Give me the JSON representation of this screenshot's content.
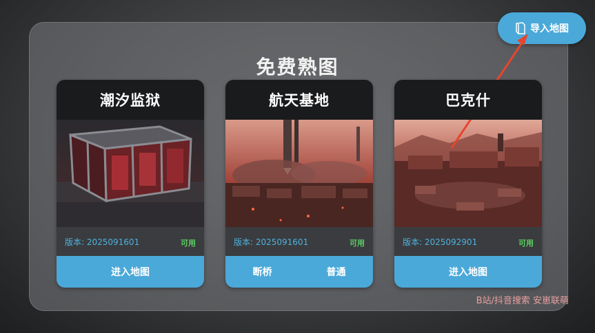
{
  "page": {
    "title": "免费熟图",
    "footer": "B站/抖音搜索 安崽联萌"
  },
  "import_button": {
    "label": "导入地图",
    "icon": "map-book-icon"
  },
  "cards": [
    {
      "title": "潮汐监狱",
      "version": "版本: 2025091601",
      "status": "可用",
      "actions": [
        "进入地图"
      ]
    },
    {
      "title": "航天基地",
      "version": "版本: 2025091601",
      "status": "可用",
      "actions": [
        "断桥",
        "普通"
      ]
    },
    {
      "title": "巴克什",
      "version": "版本: 2025092901",
      "status": "可用",
      "actions": [
        "进入地图"
      ]
    }
  ],
  "colors": {
    "accent": "#4aa9d9",
    "version_text": "#4fb3e0",
    "status_ok": "#5ccf63",
    "annotation_arrow": "#e8452f",
    "footer_text": "#e8a0a0"
  }
}
